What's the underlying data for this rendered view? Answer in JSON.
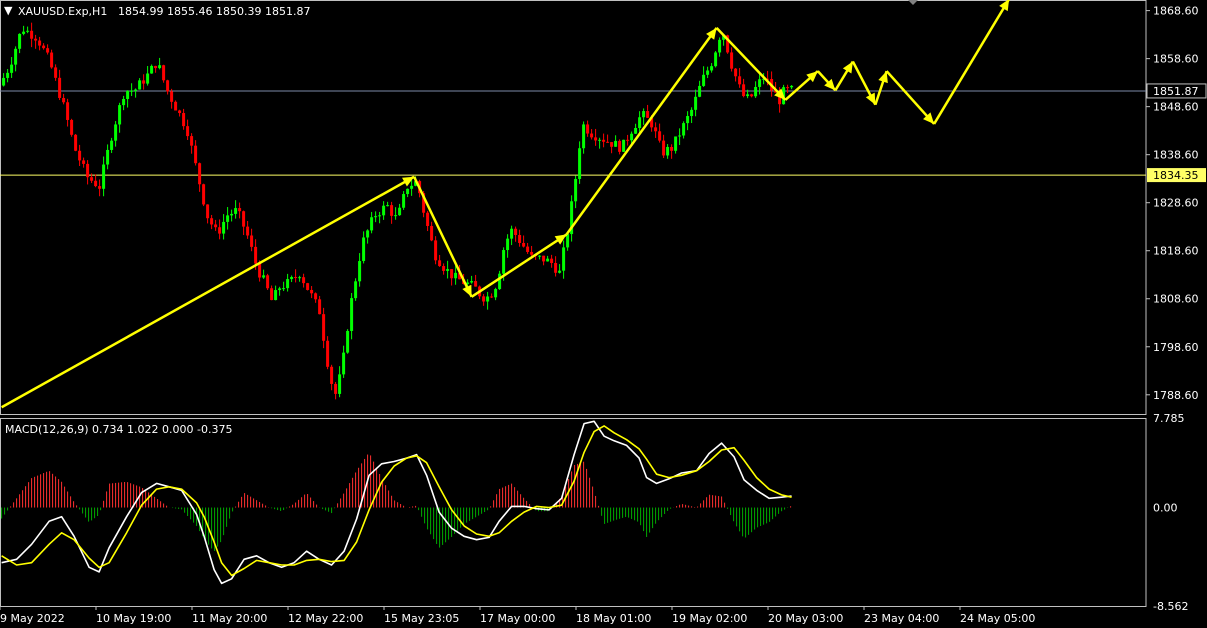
{
  "header": {
    "symbol": "XAUUSD.Exp,H1",
    "ohlc": "1854.99 1855.46 1850.39 1851.87"
  },
  "macd_header": "MACD(12,26,9) 0.734 1.022 0.000 -0.375",
  "colors": {
    "bull": "#00ff00",
    "bear": "#ff0000",
    "arrows": "#ffff00",
    "macd_line": "#ffffff",
    "signal_line": "#ffff00",
    "hist_pos": "#ff3030",
    "hist_neg": "#00aa00",
    "current_price_line": "#7c8aa8",
    "level_line": "#ffff66"
  },
  "chart_data": [
    {
      "type": "candlestick",
      "symbol": "XAUUSD.Exp",
      "timeframe": "H1",
      "ylim": [
        1784.6,
        1870.6
      ],
      "y_ticks": [
        "1868.60",
        "1858.60",
        "1848.60",
        "1838.60",
        "1828.60",
        "1818.60",
        "1808.60",
        "1798.60",
        "1788.60"
      ],
      "x_ticks": [
        "9 May 2022",
        "10 May 19:00",
        "11 May 20:00",
        "12 May 22:00",
        "15 May 23:05",
        "17 May 00:00",
        "18 May 01:00",
        "19 May 02:00",
        "20 May 03:00",
        "23 May 04:00",
        "24 May 05:00"
      ],
      "current_price": "1851.87",
      "level": "1834.35",
      "price_path": [
        [
          0,
          1853
        ],
        [
          8,
          1857
        ],
        [
          18,
          1865
        ],
        [
          30,
          1863
        ],
        [
          40,
          1858
        ],
        [
          52,
          1848
        ],
        [
          60,
          1840
        ],
        [
          70,
          1834
        ],
        [
          80,
          1832
        ],
        [
          90,
          1843
        ],
        [
          100,
          1852
        ],
        [
          108,
          1852
        ],
        [
          118,
          1855
        ],
        [
          126,
          1858
        ],
        [
          134,
          1852
        ],
        [
          142,
          1848
        ],
        [
          150,
          1844
        ],
        [
          158,
          1835
        ],
        [
          166,
          1826
        ],
        [
          174,
          1822
        ],
        [
          182,
          1826
        ],
        [
          190,
          1827
        ],
        [
          198,
          1822
        ],
        [
          206,
          1815
        ],
        [
          212,
          1812
        ],
        [
          218,
          1808
        ],
        [
          224,
          1811
        ],
        [
          232,
          1812
        ],
        [
          240,
          1814
        ],
        [
          248,
          1810
        ],
        [
          256,
          1806
        ],
        [
          262,
          1796
        ],
        [
          268,
          1788
        ],
        [
          274,
          1794
        ],
        [
          280,
          1806
        ],
        [
          290,
          1820
        ],
        [
          300,
          1826
        ],
        [
          310,
          1828
        ],
        [
          318,
          1825
        ],
        [
          326,
          1832
        ],
        [
          334,
          1833
        ],
        [
          340,
          1826
        ],
        [
          348,
          1818
        ],
        [
          356,
          1815
        ],
        [
          364,
          1813
        ],
        [
          372,
          1812
        ],
        [
          380,
          1811
        ],
        [
          386,
          1809
        ],
        [
          392,
          1809
        ],
        [
          398,
          1812
        ],
        [
          404,
          1820
        ],
        [
          410,
          1823
        ],
        [
          418,
          1820
        ],
        [
          426,
          1817
        ],
        [
          434,
          1817
        ],
        [
          442,
          1816
        ],
        [
          448,
          1814
        ],
        [
          454,
          1822
        ],
        [
          460,
          1832
        ],
        [
          466,
          1845
        ],
        [
          474,
          1843
        ],
        [
          482,
          1842
        ],
        [
          490,
          1841
        ],
        [
          498,
          1840
        ],
        [
          506,
          1844
        ],
        [
          514,
          1847
        ],
        [
          522,
          1845
        ],
        [
          530,
          1839
        ],
        [
          538,
          1840
        ],
        [
          546,
          1844
        ],
        [
          554,
          1848
        ],
        [
          562,
          1854
        ],
        [
          570,
          1858
        ],
        [
          578,
          1865
        ],
        [
          586,
          1857
        ],
        [
          594,
          1851
        ],
        [
          600,
          1850
        ],
        [
          606,
          1853
        ],
        [
          612,
          1855
        ],
        [
          618,
          1852
        ],
        [
          624,
          1850
        ],
        [
          628,
          1852
        ],
        [
          632,
          1852
        ]
      ],
      "annotations": {
        "type": "arrows",
        "points": [
          [
            0,
            1786
          ],
          [
            330,
            1834
          ],
          [
            376,
            1809
          ],
          [
            452,
            1822
          ],
          [
            572,
            1865
          ],
          [
            627,
            1850
          ],
          [
            653,
            1856
          ],
          [
            667,
            1852
          ],
          [
            681,
            1858
          ],
          [
            699,
            1849
          ],
          [
            708,
            1856
          ],
          [
            746,
            1845
          ],
          [
            806,
            1871
          ]
        ]
      }
    },
    {
      "type": "line",
      "indicator": "MACD(12,26,9)",
      "ylim": [
        -8.562,
        7.785
      ],
      "y_ticks": [
        "7.785",
        "0.00",
        "-8.562"
      ],
      "series": [
        {
          "role": "macd",
          "points": [
            [
              0,
              -4.8
            ],
            [
              12,
              -4.5
            ],
            [
              24,
              -3.2
            ],
            [
              38,
              -1.2
            ],
            [
              48,
              -0.8
            ],
            [
              58,
              -2.5
            ],
            [
              70,
              -5.2
            ],
            [
              78,
              -5.6
            ],
            [
              86,
              -3.5
            ],
            [
              100,
              -0.8
            ],
            [
              112,
              1.3
            ],
            [
              124,
              2.1
            ],
            [
              134,
              1.8
            ],
            [
              144,
              1.5
            ],
            [
              156,
              -0.6
            ],
            [
              162,
              -2.5
            ],
            [
              170,
              -5.4
            ],
            [
              176,
              -6.6
            ],
            [
              184,
              -6.2
            ],
            [
              194,
              -4.5
            ],
            [
              204,
              -4.2
            ],
            [
              214,
              -4.8
            ],
            [
              224,
              -5.2
            ],
            [
              234,
              -4.8
            ],
            [
              244,
              -3.8
            ],
            [
              254,
              -4.5
            ],
            [
              264,
              -5.0
            ],
            [
              274,
              -3.8
            ],
            [
              284,
              -1.0
            ],
            [
              294,
              2.8
            ],
            [
              304,
              3.8
            ],
            [
              314,
              4.0
            ],
            [
              324,
              4.3
            ],
            [
              332,
              4.6
            ],
            [
              340,
              2.8
            ],
            [
              350,
              -0.4
            ],
            [
              360,
              -1.8
            ],
            [
              370,
              -2.5
            ],
            [
              380,
              -2.8
            ],
            [
              390,
              -2.6
            ],
            [
              398,
              -1.2
            ],
            [
              408,
              0.1
            ],
            [
              418,
              0.1
            ],
            [
              428,
              -0.1
            ],
            [
              438,
              -0.2
            ],
            [
              448,
              0.8
            ],
            [
              458,
              4.6
            ],
            [
              466,
              7.3
            ],
            [
              474,
              7.5
            ],
            [
              482,
              6.2
            ],
            [
              490,
              5.8
            ],
            [
              500,
              5.4
            ],
            [
              510,
              4.3
            ],
            [
              516,
              2.6
            ],
            [
              524,
              2.1
            ],
            [
              534,
              2.5
            ],
            [
              544,
              3.0
            ],
            [
              556,
              3.2
            ],
            [
              566,
              4.7
            ],
            [
              576,
              5.6
            ],
            [
              586,
              4.4
            ],
            [
              594,
              2.4
            ],
            [
              604,
              1.5
            ],
            [
              614,
              0.8
            ],
            [
              624,
              0.9
            ],
            [
              632,
              1.0
            ]
          ]
        },
        {
          "role": "signal",
          "points": [
            [
              0,
              -4.2
            ],
            [
              12,
              -5.0
            ],
            [
              24,
              -4.8
            ],
            [
              38,
              -3.2
            ],
            [
              48,
              -2.2
            ],
            [
              58,
              -2.8
            ],
            [
              70,
              -4.4
            ],
            [
              78,
              -5.2
            ],
            [
              86,
              -4.8
            ],
            [
              100,
              -2.2
            ],
            [
              112,
              0.2
            ],
            [
              124,
              1.6
            ],
            [
              134,
              1.8
            ],
            [
              144,
              1.6
            ],
            [
              156,
              0.4
            ],
            [
              162,
              -0.8
            ],
            [
              170,
              -3.0
            ],
            [
              176,
              -4.8
            ],
            [
              184,
              -5.9
            ],
            [
              194,
              -5.3
            ],
            [
              204,
              -4.6
            ],
            [
              214,
              -4.8
            ],
            [
              224,
              -5.0
            ],
            [
              234,
              -5.0
            ],
            [
              244,
              -4.6
            ],
            [
              254,
              -4.5
            ],
            [
              264,
              -4.7
            ],
            [
              274,
              -4.6
            ],
            [
              284,
              -3.0
            ],
            [
              294,
              -0.2
            ],
            [
              304,
              2.2
            ],
            [
              314,
              3.6
            ],
            [
              324,
              4.3
            ],
            [
              332,
              4.5
            ],
            [
              340,
              3.9
            ],
            [
              350,
              1.8
            ],
            [
              360,
              -0.2
            ],
            [
              370,
              -1.6
            ],
            [
              380,
              -2.3
            ],
            [
              390,
              -2.5
            ],
            [
              398,
              -2.2
            ],
            [
              408,
              -1.2
            ],
            [
              418,
              -0.4
            ],
            [
              428,
              0.1
            ],
            [
              438,
              0.0
            ],
            [
              448,
              0.2
            ],
            [
              458,
              2.3
            ],
            [
              466,
              4.8
            ],
            [
              474,
              6.6
            ],
            [
              482,
              7.1
            ],
            [
              490,
              6.5
            ],
            [
              500,
              5.9
            ],
            [
              510,
              5.1
            ],
            [
              516,
              4.2
            ],
            [
              524,
              2.9
            ],
            [
              534,
              2.6
            ],
            [
              544,
              2.8
            ],
            [
              556,
              3.2
            ],
            [
              566,
              4.0
            ],
            [
              576,
              5.0
            ],
            [
              586,
              5.2
            ],
            [
              594,
              4.1
            ],
            [
              604,
              2.6
            ],
            [
              614,
              1.6
            ],
            [
              624,
              1.1
            ],
            [
              632,
              0.9
            ]
          ]
        }
      ]
    }
  ]
}
